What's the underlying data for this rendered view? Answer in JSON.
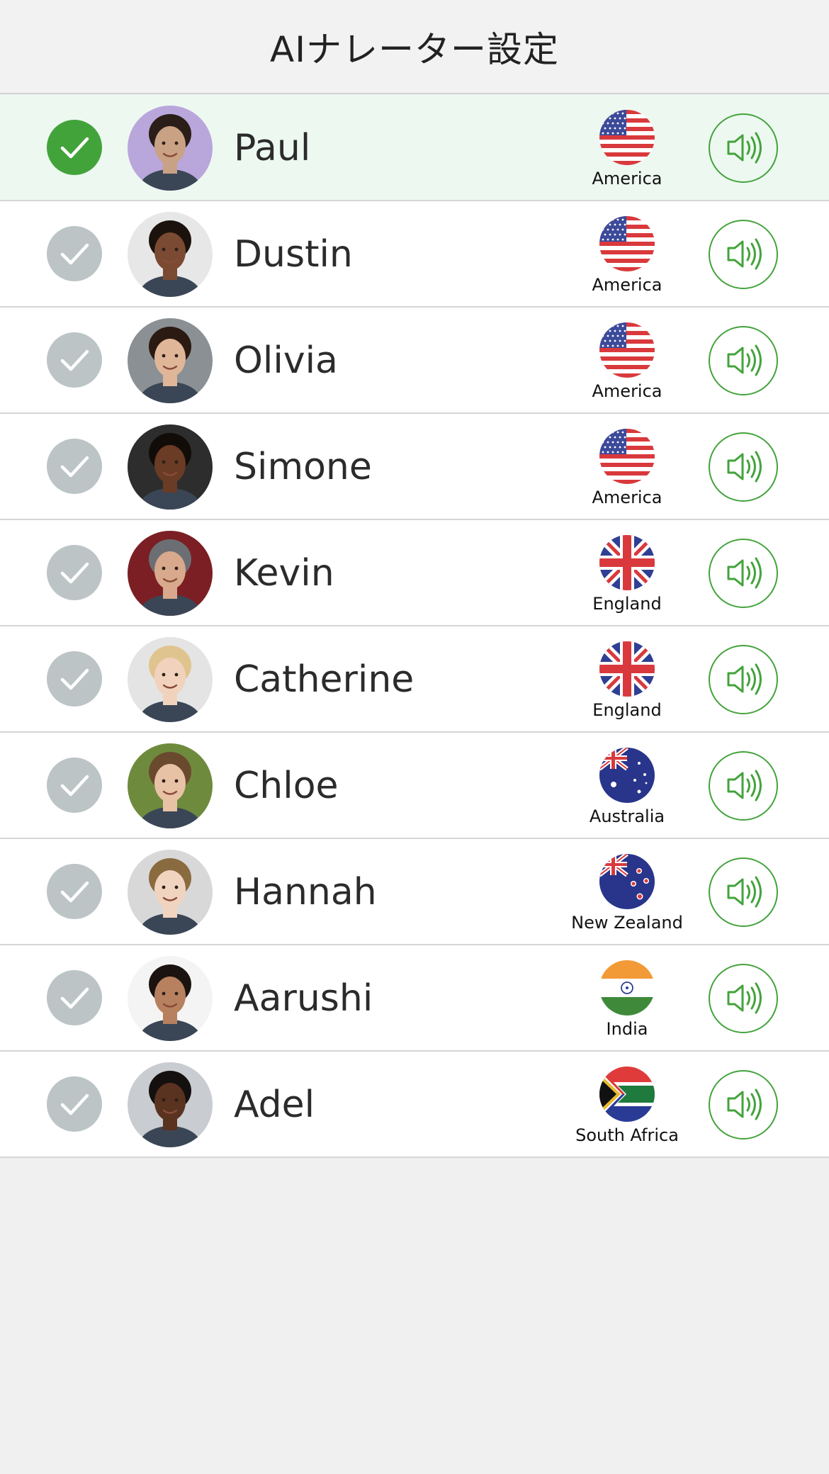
{
  "header": {
    "title": "AIナレーター設定"
  },
  "colors": {
    "accent": "#43a33b",
    "selected_row_bg": "#edf8f1",
    "unchecked": "#bcc4c6"
  },
  "narrators": [
    {
      "name": "Paul",
      "country": "America",
      "flag_icon": "usa-flag-icon",
      "selected": true
    },
    {
      "name": "Dustin",
      "country": "America",
      "flag_icon": "usa-flag-icon",
      "selected": false
    },
    {
      "name": "Olivia",
      "country": "America",
      "flag_icon": "usa-flag-icon",
      "selected": false
    },
    {
      "name": "Simone",
      "country": "America",
      "flag_icon": "usa-flag-icon",
      "selected": false
    },
    {
      "name": "Kevin",
      "country": "England",
      "flag_icon": "uk-flag-icon",
      "selected": false
    },
    {
      "name": "Catherine",
      "country": "England",
      "flag_icon": "uk-flag-icon",
      "selected": false
    },
    {
      "name": "Chloe",
      "country": "Australia",
      "flag_icon": "australia-flag-icon",
      "selected": false
    },
    {
      "name": "Hannah",
      "country": "New Zealand",
      "flag_icon": "new-zealand-flag-icon",
      "selected": false
    },
    {
      "name": "Aarushi",
      "country": "India",
      "flag_icon": "india-flag-icon",
      "selected": false
    },
    {
      "name": "Adel",
      "country": "South Africa",
      "flag_icon": "south-africa-flag-icon",
      "selected": false
    }
  ]
}
